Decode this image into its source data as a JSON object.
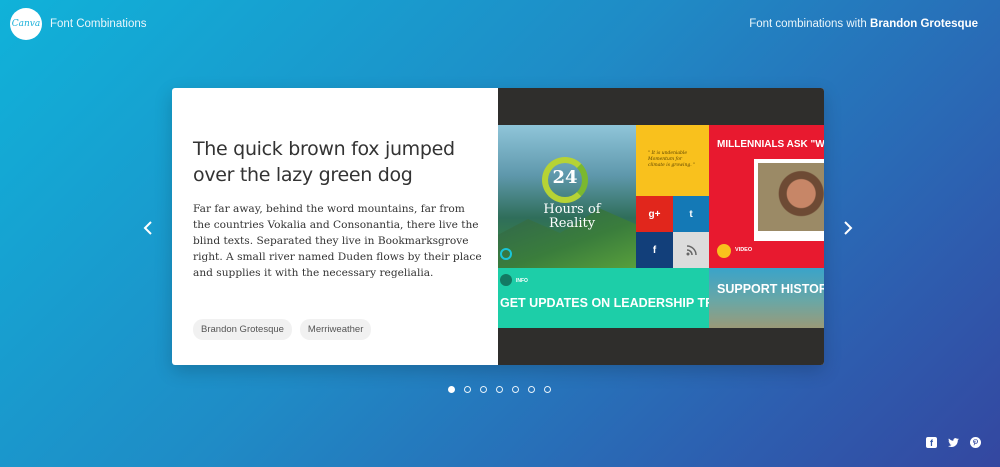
{
  "header": {
    "logo_text": "Canva",
    "app_title": "Font Combinations",
    "right_prefix": "Font combinations with",
    "right_font": "Brandon Grotesque"
  },
  "card": {
    "heading": "The quick brown fox jumped over the lazy green dog",
    "body": "Far far away, behind the word mountains, far from the countries Vokalia and Consonantia, there live the blind texts. Separated they live in Bookmarksgrove right. A small river named Duden flows by their place and supplies it with the necessary regelialia.",
    "tags": [
      "Brandon Grotesque",
      "Merriweather"
    ]
  },
  "preview": {
    "photo_number": "24",
    "photo_caption": "Hours of Reality",
    "quote": "\" It is undeniable Momentum for climate is growing. \"",
    "social_tiles": [
      "g+",
      "t",
      "f",
      "rss"
    ],
    "red_title": "MILLENNIALS ASK \"W",
    "red_label": "VIDEO",
    "teal_label": "INFO",
    "teal_title": "GET UPDATES ON LEADERSHIP TRAININGS",
    "support_title": "SUPPORT HISTORIC LIMITS ON CARBON"
  },
  "carousel": {
    "slide_count": 7,
    "active_index": 0
  },
  "footer": {
    "social": [
      "facebook-icon",
      "twitter-icon",
      "pinterest-icon"
    ]
  },
  "colors": {
    "background_start": "#10b2d9",
    "background_end": "#3447a0",
    "accent_yellow": "#f9c11d",
    "accent_red": "#e8192f",
    "accent_teal": "#1dcea8"
  }
}
